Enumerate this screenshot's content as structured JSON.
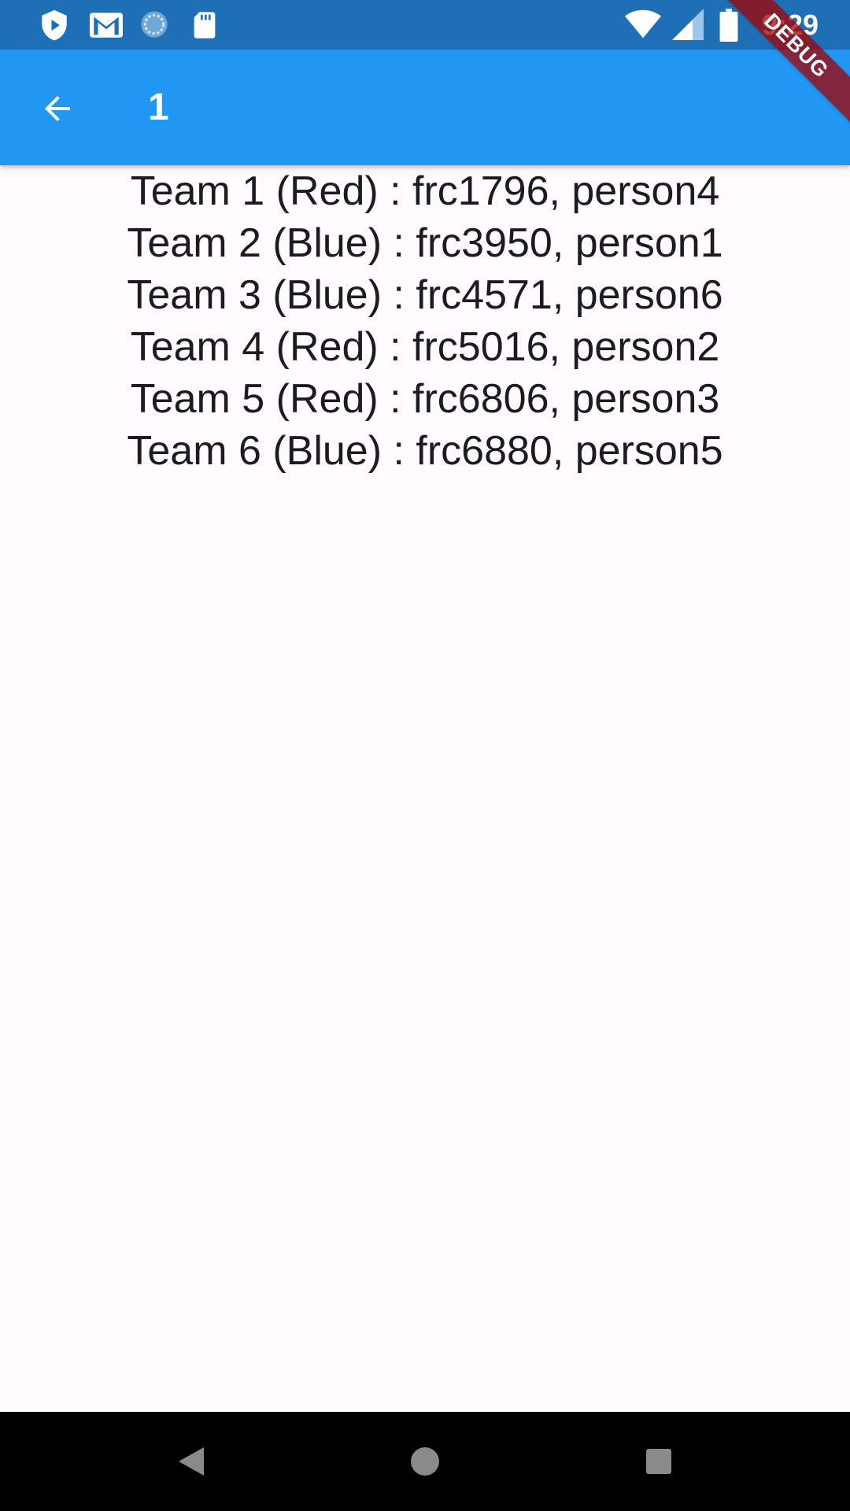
{
  "status_bar": {
    "time": "9:29",
    "left_icons": [
      "shield-play-icon",
      "gmail-icon",
      "sync-circle-icon",
      "sd-card-icon"
    ],
    "right_icons": [
      "wifi-icon",
      "signal-icon",
      "battery-icon"
    ],
    "color": "#1f6fb6"
  },
  "app_bar": {
    "title": "1",
    "color": "#2196f3"
  },
  "debug_banner": {
    "label": "DEBUG"
  },
  "teams": [
    "Team 1 (Red) : frc1796, person4",
    "Team 2 (Blue) : frc3950, person1",
    "Team 3 (Blue) : frc4571, person6",
    "Team 4 (Red) : frc5016, person2",
    "Team 5 (Red) : frc6806, person3",
    "Team 6 (Blue) : frc6880, person5"
  ],
  "nav_bar": {
    "buttons": [
      "back-triangle-icon",
      "home-circle-icon",
      "recents-square-icon"
    ]
  }
}
